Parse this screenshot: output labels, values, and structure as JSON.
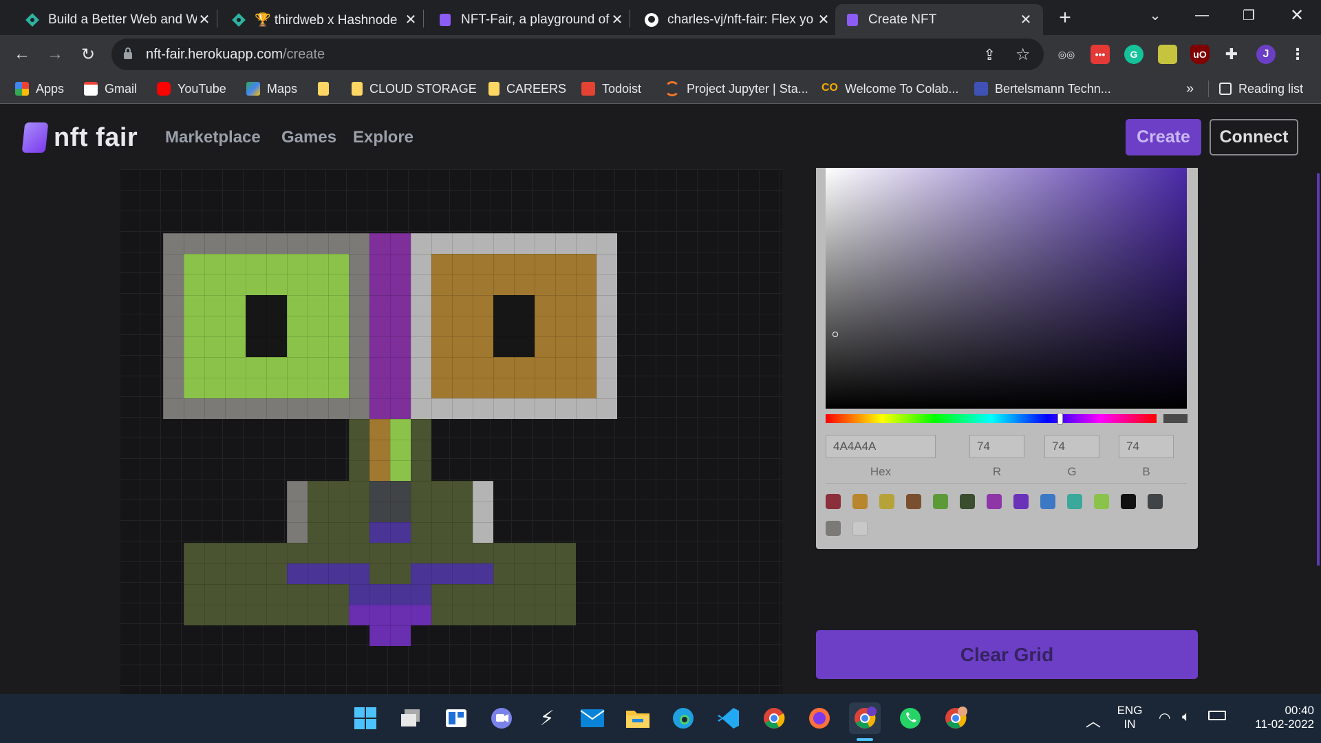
{
  "tabs": [
    {
      "title": "Build a Better Web and W",
      "icon_color": "#2db3a0"
    },
    {
      "title": "🏆 thirdweb x Hashnode",
      "icon_color": "#2db3a0"
    },
    {
      "title": "NFT-Fair, a playground of",
      "icon_color": "#8b5cf6"
    },
    {
      "title": "charles-vj/nft-fair: Flex yo",
      "icon_color": "#ffffff"
    },
    {
      "title": "Create NFT",
      "icon_color": "#8b5cf6"
    }
  ],
  "address_bar": {
    "domain": "nft-fair.herokuapp.com",
    "path": "/create"
  },
  "bookmarks": [
    {
      "label": "Apps",
      "color": "#e8453c"
    },
    {
      "label": "Gmail",
      "color": "#ea4335"
    },
    {
      "label": "YouTube",
      "color": "#ff0000"
    },
    {
      "label": "Maps",
      "color": "#34a853"
    },
    {
      "label": "",
      "color": "#fdd663"
    },
    {
      "label": "CLOUD STORAGE",
      "color": "#fdd663"
    },
    {
      "label": "CAREERS",
      "color": "#fdd663"
    },
    {
      "label": "Todoist",
      "color": "#e44232"
    },
    {
      "label": "Project Jupyter | Sta...",
      "color": "#f37626"
    },
    {
      "label": "Welcome To Colab...",
      "color": "#f9ab00"
    },
    {
      "label": "Bertelsmann Techn...",
      "color": "#3f51b5"
    }
  ],
  "reading_list": "Reading list",
  "more_bookmarks": "»",
  "site": {
    "logo": "nft fair",
    "nav": [
      "Marketplace",
      "Games",
      "Explore"
    ],
    "create": "Create",
    "connect": "Connect"
  },
  "picker": {
    "hex": "4A4A4A",
    "r": "74",
    "g": "74",
    "b": "74",
    "labels": {
      "hex": "Hex",
      "r": "R",
      "g": "G",
      "b": "B"
    },
    "swatches": [
      "#8b2f3c",
      "#b8862c",
      "#b5a33a",
      "#7a4f2f",
      "#5c9a37",
      "#3a4d2e",
      "#8e36a8",
      "#6a32b8",
      "#3d78c4",
      "#3aa89a",
      "#8bc34a",
      "#111111",
      "#414447",
      "#7c7a76",
      "#cccccc"
    ]
  },
  "clear_grid": "Clear Grid",
  "taskbar": {
    "lang": "ENG",
    "region": "IN",
    "time": "00:40",
    "date": "11-02-2022",
    "profile_letter": "J"
  }
}
